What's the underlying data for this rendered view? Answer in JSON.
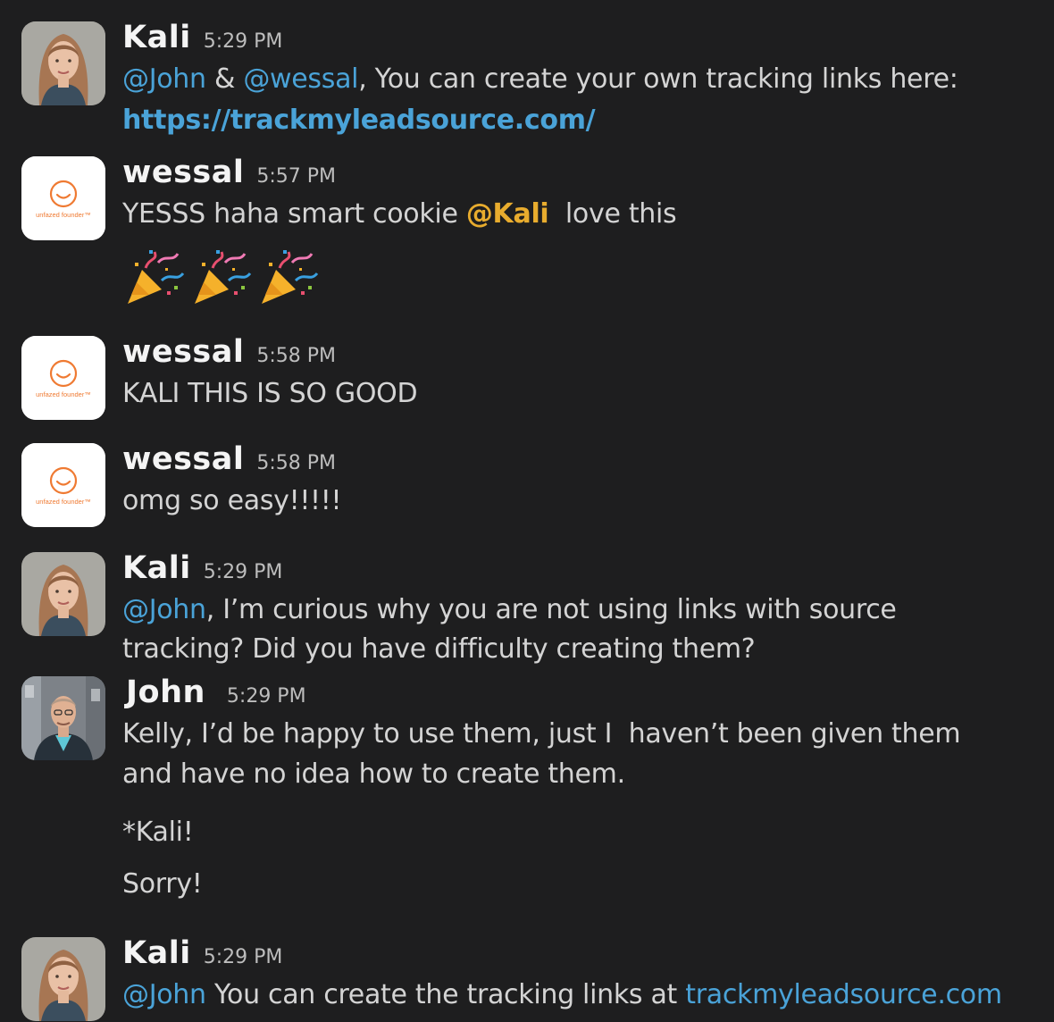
{
  "messages": [
    {
      "author": "Kali",
      "time": "5:29 PM",
      "lines": [
        {
          "mention1": "@John",
          "t1": " & ",
          "mention2": "@wessal",
          "t2": ", You can create your own tracking links here:"
        },
        {
          "link": "https://trackmyleadsource.com/"
        }
      ]
    },
    {
      "author": "wessal",
      "time": "5:57 PM",
      "avatar_text": "unfazed founder™",
      "text_before": "YESSS haha smart cookie ",
      "mention": "@Kali",
      "text_after": "  love this",
      "emoji": [
        "party-popper",
        "party-popper",
        "party-popper"
      ]
    },
    {
      "author": "wessal",
      "time": "5:58 PM",
      "avatar_text": "unfazed founder™",
      "text": "KALI THIS IS SO GOOD"
    },
    {
      "author": "wessal",
      "time": "5:58 PM",
      "avatar_text": "unfazed founder™",
      "text": "omg so easy!!!!!"
    },
    {
      "author": "Kali",
      "time": "5:29 PM",
      "mention": "@John",
      "line1": ", I’m curious why you are not using links with source",
      "line2": "tracking? Did you have difficulty creating them?"
    },
    {
      "author": "John",
      "time": "5:29 PM",
      "line1": "Kelly, I’d be happy to use them, just I  haven’t been given them",
      "line2": "and have no idea how to create them.",
      "line3": "*Kali!",
      "line4": "Sorry!"
    },
    {
      "author": "Kali",
      "time": "5:29 PM",
      "mention": "@John",
      "text": " You can create the tracking links at ",
      "link": "trackmyleadsource.com"
    }
  ],
  "colors": {
    "background": "#1e1e1f",
    "mention": "#4aa3d8",
    "self_mention": "#e8ac2e",
    "link": "#4aa3d8",
    "brand_orange": "#ef7a32"
  }
}
